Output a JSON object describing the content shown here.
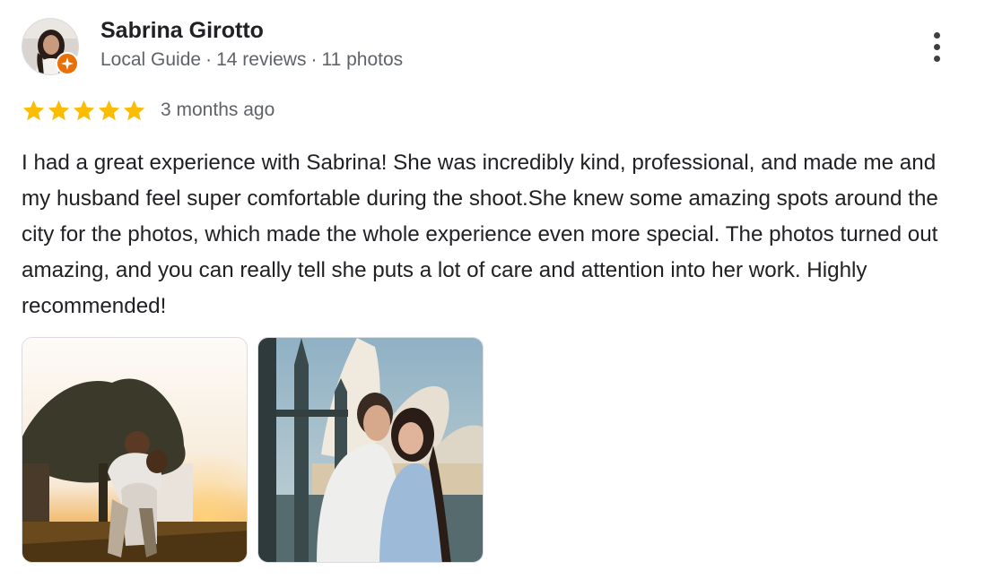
{
  "reviewer": {
    "name": "Sabrina Girotto",
    "level": "Local Guide",
    "reviews": "14 reviews",
    "photos": "11 photos",
    "separator": "·",
    "avatar_icon": "user-avatar-photo",
    "badge_icon": "local-guide-star-badge",
    "badge_color": "#e8710a"
  },
  "rating": {
    "stars": 5,
    "max": 5,
    "star_color": "#fbbc04",
    "time_ago": "3 months ago"
  },
  "review": {
    "text": "I had a great experience with Sabrina! She was incredibly kind, professional, and made me and my husband feel super comfortable during the shoot.She knew some amazing spots around the city for the photos, which made the whole experience even more special. The photos turned out amazing, and you can really tell she puts a lot of care and attention into her work. Highly recommended!"
  },
  "photos": [
    {
      "icon": "sunset-couple-photo"
    },
    {
      "icon": "opera-house-couple-photo"
    }
  ],
  "actions": {
    "more_icon": "more-vert-icon"
  }
}
